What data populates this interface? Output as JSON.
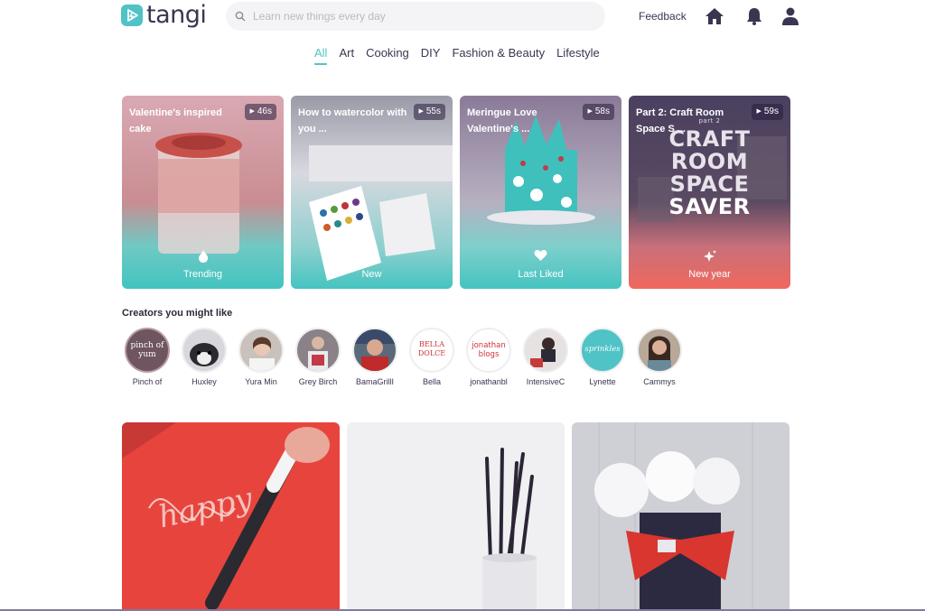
{
  "header": {
    "logo_text": "tangi",
    "search_placeholder": "Learn new things every day",
    "feedback_label": "Feedback",
    "icons": [
      "home-icon",
      "bell-icon",
      "user-icon"
    ]
  },
  "categories": [
    {
      "label": "All",
      "active": true
    },
    {
      "label": "Art"
    },
    {
      "label": "Cooking"
    },
    {
      "label": "DIY"
    },
    {
      "label": "Fashion & Beauty"
    },
    {
      "label": "Lifestyle"
    }
  ],
  "features": [
    {
      "title": "Valentine's inspired cake",
      "duration": "46s",
      "badge": "Trending",
      "badge_icon": "flame-icon"
    },
    {
      "title": "How to watercolor with you ...",
      "duration": "55s",
      "badge": "New",
      "badge_icon": "sprout-icon"
    },
    {
      "title": "Meringue Love Valentine's ...",
      "duration": "58s",
      "badge": "Last Liked",
      "badge_icon": "heart-icon"
    },
    {
      "title": "Part 2: Craft Room Space S ...",
      "duration": "59s",
      "badge": "New year",
      "badge_icon": "sparkle-icon",
      "overlay_text": [
        "CRAFT",
        "ROOM",
        "SPACE",
        "SAVER"
      ],
      "overlay_small": "part 2"
    }
  ],
  "creators": {
    "title": "Creators you might like",
    "items": [
      {
        "name": "Pinch of",
        "avatar_text": "pinch of yum"
      },
      {
        "name": "Huxley"
      },
      {
        "name": "Yura Min"
      },
      {
        "name": "Grey Birch"
      },
      {
        "name": "BamaGrillI"
      },
      {
        "name": "Bella",
        "avatar_text": "BELLA DOLCE"
      },
      {
        "name": "jonathanbl",
        "avatar_text": "jonathan blogs"
      },
      {
        "name": "IntensiveC"
      },
      {
        "name": "Lynette",
        "avatar_text": "sprinkles"
      },
      {
        "name": "Cammys"
      }
    ]
  },
  "tiles": [
    {
      "name": "lettering-pen-tile",
      "overlay_text": "happy"
    },
    {
      "name": "paint-brushes-tile"
    },
    {
      "name": "paper-roses-tile"
    }
  ],
  "colors": {
    "accent": "#4fc3c5",
    "dark": "#3b3551",
    "coral": "#f0685e"
  }
}
